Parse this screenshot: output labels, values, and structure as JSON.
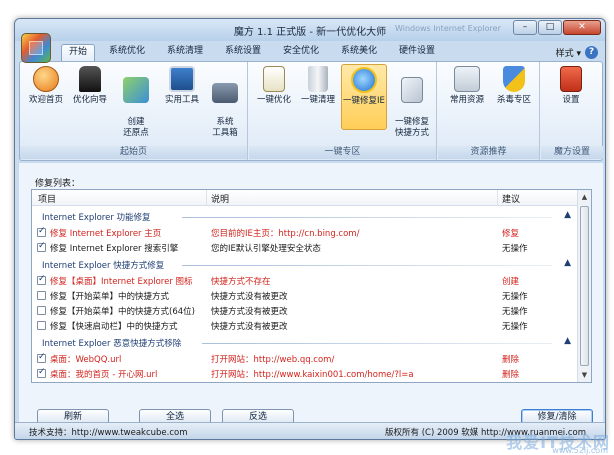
{
  "window": {
    "title": "魔方 1.1 正式版 - 新一代优化大师",
    "ghost_title": "Windows Internet Explorer"
  },
  "window_buttons": {
    "minimize": "–",
    "maximize": "□",
    "close": "✕"
  },
  "tabs": [
    "开始",
    "系统优化",
    "系统清理",
    "系统设置",
    "安全优化",
    "系统美化",
    "硬件设置"
  ],
  "style_menu": "样式 ▾",
  "help_label": "?",
  "ribbon": {
    "groups": [
      {
        "label": "起始页",
        "buttons": [
          "欢迎首页",
          "优化向导",
          "创建\n还原点",
          "实用工具",
          "系统\n工具箱"
        ]
      },
      {
        "label": "一键专区",
        "buttons": [
          "一键优化",
          "一键清理",
          "一键修复IE",
          "一键修复\n快捷方式"
        ]
      },
      {
        "label": "资源推荐",
        "buttons": [
          "常用资源",
          "杀毒专区"
        ]
      },
      {
        "label": "魔方设置",
        "buttons": [
          "设置"
        ]
      }
    ]
  },
  "repair": {
    "list_title": "修复列表：",
    "columns": [
      "项目",
      "说明",
      "建议"
    ],
    "groups": [
      {
        "name": "Internet Explorer 功能修复",
        "items": [
          {
            "checked": true,
            "red": true,
            "item": "修复 Internet Explorer 主页",
            "desc": "您目前的IE主页：http://cn.bing.com/",
            "advice": "修复"
          },
          {
            "checked": true,
            "red": false,
            "item": "修复 Internet Explorer 搜索引擎",
            "desc": "您的IE默认引擎处理安全状态",
            "advice": "无操作"
          }
        ]
      },
      {
        "name": "Internet Exploer 快捷方式修复",
        "items": [
          {
            "checked": true,
            "red": true,
            "item": "修复【桌面】Internet Explorer 图标",
            "desc": "快捷方式不存在",
            "advice": "创建"
          },
          {
            "checked": false,
            "red": false,
            "item": "修复【开始菜单】中的快捷方式",
            "desc": "快捷方式没有被更改",
            "advice": "无操作"
          },
          {
            "checked": false,
            "red": false,
            "item": "修复【开始菜单】中的快捷方式(64位)",
            "desc": "快捷方式没有被更改",
            "advice": "无操作"
          },
          {
            "checked": false,
            "red": false,
            "item": "修复【快速启动栏】中的快捷方式",
            "desc": "快捷方式没有被更改",
            "advice": "无操作"
          }
        ]
      },
      {
        "name": "Internet Exploer 恶意快捷方式移除",
        "items": [
          {
            "checked": true,
            "red": true,
            "item": "桌面：WebQQ.url",
            "desc": "打开网站：http://web.qq.com/",
            "advice": "删除"
          },
          {
            "checked": true,
            "red": true,
            "item": "桌面：我的首页 - 开心网.url",
            "desc": "打开网站：http://www.kaixin001.com/home/?l=a",
            "advice": "删除"
          }
        ]
      }
    ],
    "collapse_symbol": "▲"
  },
  "buttons": {
    "refresh": "刷新",
    "select_all": "全选",
    "invert": "反选",
    "repair_clean": "修复/清除"
  },
  "status": {
    "support": "技术支持：http://www.tweakcube.com",
    "copyright": "版权所有 (C) 2009 软媒 http://www.ruanmei.com"
  },
  "watermark": {
    "main": "我爱IT技术网",
    "sub": "www.52ij.com"
  },
  "colors": {
    "accent_red": "#d2231d",
    "group_blue": "#1f3e74",
    "active_button": "#ffce57"
  }
}
